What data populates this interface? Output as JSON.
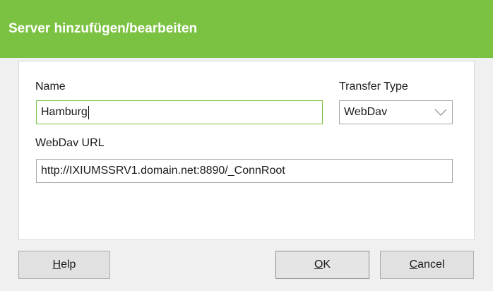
{
  "window": {
    "title": "Server hinzufügen/bearbeiten"
  },
  "form": {
    "name_label": "Name",
    "name_value": "Hamburg",
    "transfer_type_label": "Transfer Type",
    "transfer_type_value": "WebDav",
    "url_label": "WebDav URL",
    "url_value": "http://IXIUMSSRV1.domain.net:8890/_ConnRoot"
  },
  "buttons": {
    "help": {
      "mnemonic": "H",
      "rest": "elp"
    },
    "ok": {
      "mnemonic": "O",
      "rest": "K"
    },
    "cancel": {
      "mnemonic": "C",
      "rest": "ancel"
    }
  },
  "colors": {
    "accent": "#7cc242",
    "title_text": "#ffffff",
    "background": "#f0f0f0"
  },
  "icons": {
    "dropdown": "chevron-down-icon"
  }
}
